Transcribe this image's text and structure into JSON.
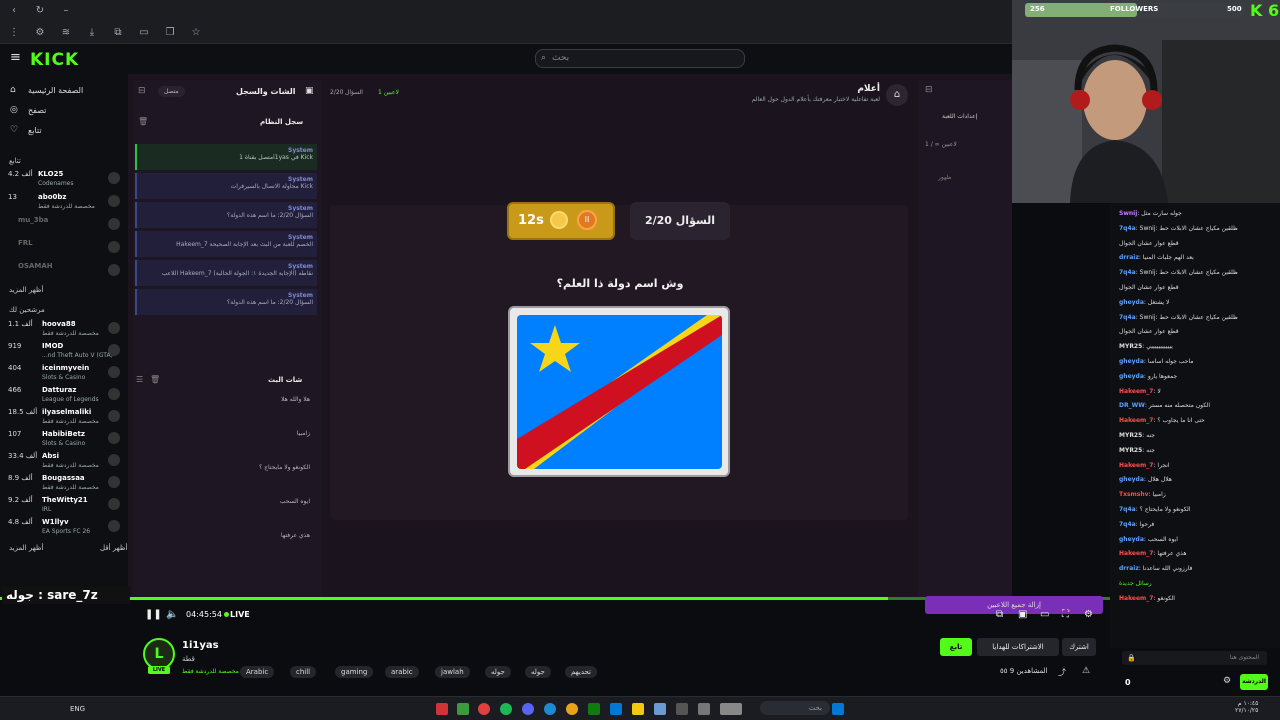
{
  "search": {
    "placeholder": "بحث"
  },
  "sidebar": {
    "nav": [
      {
        "label": "الصفحة الرئيسية",
        "icon": "home-icon"
      },
      {
        "label": "تصفح",
        "icon": "compass-icon"
      },
      {
        "label": "تتابع",
        "icon": "heart-icon"
      }
    ],
    "following_label": "تتابع",
    "show_more_1": "أظهر المزيد",
    "recommended_label": "مرشحين لك",
    "show_more_2": "أظهر المزيد",
    "show_less": "أظهر أقل",
    "channels_following": [
      {
        "count": "4.2 ألف",
        "name": "KLO25",
        "game": "Codenames",
        "live": true
      },
      {
        "count": "13",
        "name": "abo0bz",
        "game": "مخصصة للدردشة فقط",
        "live": false
      },
      {
        "count": "",
        "name": "mu_3ba",
        "game": "",
        "live": false
      },
      {
        "count": "",
        "name": "FRL",
        "game": "",
        "live": false
      },
      {
        "count": "",
        "name": "OSAMAH",
        "game": "",
        "live": false
      }
    ],
    "channels_recommended": [
      {
        "count": "1.1 ألف",
        "name": "hoova88",
        "game": "مخصصة للدردشة فقط"
      },
      {
        "count": "919",
        "name": "IMOD",
        "game": "...nd Theft Auto V (GTA)"
      },
      {
        "count": "404",
        "name": "iceinmyvein",
        "game": "Slots & Casino"
      },
      {
        "count": "466",
        "name": "Datturaz",
        "game": "League of Legends"
      },
      {
        "count": "18.5 ألف",
        "name": "ilyaselmaliki",
        "game": "مخصصة للدردشة فقط"
      },
      {
        "count": "107",
        "name": "HabibiBetz",
        "game": "Slots & Casino"
      },
      {
        "count": "33.4 ألف",
        "name": "Absi",
        "game": "مخصصة للدردشة فقط"
      },
      {
        "count": "8.9 ألف",
        "name": "Bougassaa",
        "game": "مخصصة للدردشة فقط"
      },
      {
        "count": "9.2 ألف",
        "name": "TheWitty21",
        "game": "IRL"
      },
      {
        "count": "4.8 ألف",
        "name": "W1llyv",
        "game": "EA Sports FC 26"
      }
    ]
  },
  "stage": {
    "chat_panel_title": "الشات والسجل",
    "chat_panel_status": "متصل",
    "system_log_title": "سجل النظام",
    "live_chat_title": "شات البث",
    "top_counter": "2/20",
    "top_question_label": "السؤال",
    "top_players": "1 لاعبين",
    "game_title": "أعلام",
    "game_subtitle": "لعبة تفاعلية لاختبار معرفتك بأعلام الدول حول العالم",
    "timer_value": "12s",
    "question_number": "السؤال 2/20",
    "question_text": "وش اسم دولة ذا العلم؟",
    "right_panel_title": "إعدادات اللعبة",
    "right_panel_players": "1 / ∞ لاعبين",
    "right_panel_wait": "ظهور",
    "bottom_action": "إزالة جميع اللاعبين"
  },
  "system_log": [
    "متصل بقناة 1i1yas في Kick",
    "محاولة الاتصال بالسيرفرات Kick",
    "السؤال 2/20: ما اسم هذه الدولة؟",
    "Hakeem_7 الخصم للعبة من البث بعد الإجابة الصحيحة",
    "اللاعب Hakeem_7 (الإجابة الجديدة ١: الجولة الحالية) نقاطه",
    "السؤال 2/20: ما اسم هذه الدولة؟"
  ],
  "live_chat_preview": [
    "هلا والله هلا",
    "زامبيا",
    "الكونغو ولا مايحتاج ؟",
    "ايوه السحب",
    "هذي عرفتها"
  ],
  "player": {
    "time": "04:45:54",
    "live": "LIVE",
    "progress_pct": 80
  },
  "overlay": {
    "text": "جوله : sare_7z"
  },
  "streamer": {
    "name": "1i1yas",
    "title": "قطة",
    "category": "مخصصة للدردشة فقط",
    "tags": [
      "Arabic",
      "chill",
      "gaming",
      "arabic",
      "jawlah",
      "جوله",
      "جوله",
      "تحديهم"
    ],
    "follow_label": "تابع",
    "subs_label": "الاشتراكات للهدايا",
    "sub_label": "اشترك",
    "viewers": "المشاهدين 9 ٥٥"
  },
  "followers_goal": {
    "current": "256",
    "label": "FOLLOWERS",
    "goal": "500",
    "fraction": 0.51
  },
  "chat": {
    "messages": [
      {
        "user": "Swnij",
        "color": "#c77dff",
        "text": "جوله سارت مثل"
      },
      {
        "user": "7q4a",
        "color": "#5ea0ff",
        "text": "Swnij: ظلقين مكياج عشان الابلات حط"
      },
      {
        "user": "",
        "color": "#ddd",
        "text": "قطع عوار عشان الجوال"
      },
      {
        "user": "drraiz",
        "color": "#5ea0ff",
        "text": "بعد الهم جلبات المنيا"
      },
      {
        "user": "7q4a",
        "color": "#5ea0ff",
        "text": "Swnij: ظلقين مكياج عشان الابلات حط"
      },
      {
        "user": "",
        "color": "#ddd",
        "text": "قطع عوار عشان الجوال"
      },
      {
        "user": "gheyda",
        "color": "#5ea0ff",
        "text": "لا يشتغل"
      },
      {
        "user": "7q4a",
        "color": "#5ea0ff",
        "text": "Swnij: ظلقين مكياج عشان الابلات حط"
      },
      {
        "user": "",
        "color": "#ddd",
        "text": "قطع عوار عشان الجوال"
      },
      {
        "user": "MYR25",
        "color": "#dddddd",
        "text": "ييييييييييييي"
      },
      {
        "user": "gheyda",
        "color": "#5ea0ff",
        "text": "ماحب جوله اساساً"
      },
      {
        "user": "gheyda",
        "color": "#5ea0ff",
        "text": "جمعوها يارو"
      },
      {
        "user": "Hakeem_7",
        "color": "#ff4d4d",
        "text": "لا"
      },
      {
        "user": "DR_WW",
        "color": "#5ea0ff",
        "text": "الكون متحصله منه مستر"
      },
      {
        "user": "Hakeem_7",
        "color": "#ff4d4d",
        "text": "حتى انا ما يجاوب ؟"
      },
      {
        "user": "MYR25",
        "color": "#dddddd",
        "text": "جنه"
      },
      {
        "user": "MYR25",
        "color": "#dddddd",
        "text": "جنه"
      },
      {
        "user": "Hakeem_7",
        "color": "#ff4d4d",
        "text": "انجرا"
      },
      {
        "user": "gheyda",
        "color": "#5ea0ff",
        "text": "هلال هلال"
      },
      {
        "user": "Txsmshv",
        "color": "#ff4d4d",
        "text": "زامبيا"
      },
      {
        "user": "7q4a",
        "color": "#5ea0ff",
        "text": "الكونغو ولا مايحتاج ؟"
      },
      {
        "user": "7q4a",
        "color": "#5ea0ff",
        "text": "فرحوا"
      },
      {
        "user": "gheyda",
        "color": "#5ea0ff",
        "text": "ايوه السحب"
      },
      {
        "user": "Hakeem_7",
        "color": "#ff4d4d",
        "text": "هذي عرفتها"
      },
      {
        "user": "drraiz",
        "color": "#5ea0ff",
        "text": "فأرزوني الله ساعدنا"
      },
      {
        "user": "",
        "color": "#53fc18",
        "text": "رسائل جديدة"
      },
      {
        "user": "Hakeem_7",
        "color": "#ff4d4d",
        "text": "الكونغو"
      }
    ],
    "input_placeholder": "المحتوى هنا",
    "send_label": "الدردشة",
    "count": "0"
  },
  "taskbar": {
    "lang": "ENG",
    "search": "بحث",
    "time": "١٠:٤٥ م",
    "date": "٢٧/١٠/٢٥"
  },
  "colors": {
    "accent": "#53fc18",
    "stage_bg": "#1b141f",
    "timer": "#c99a1a",
    "flag_blue": "#007fff",
    "flag_yellow": "#f7d618",
    "flag_red": "#ce1021"
  }
}
